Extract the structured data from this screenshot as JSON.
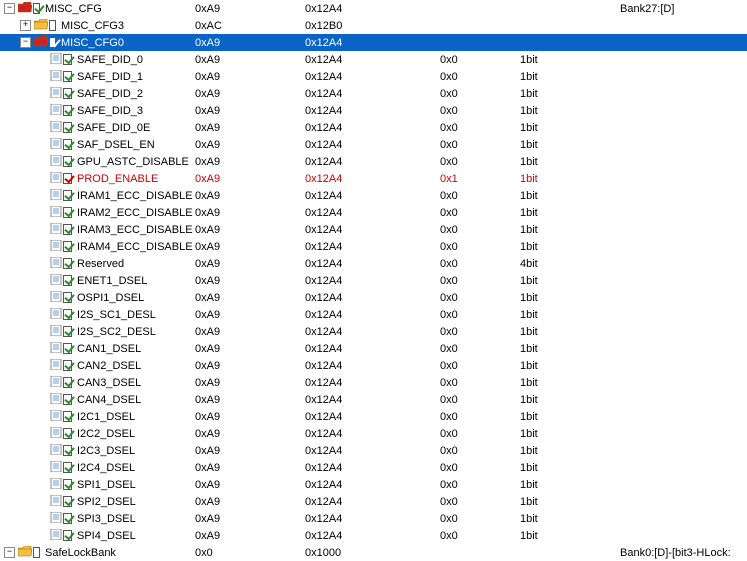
{
  "rows": [
    {
      "indent": 0,
      "toggle": "minus",
      "icon": "folder",
      "iconColor": "red",
      "check": "on",
      "label": "MISC_CFG",
      "c1": "0xA9",
      "c2": "0x12A4",
      "c3": "",
      "c4": "",
      "c5": "Bank27:[D]"
    },
    {
      "indent": 1,
      "toggle": "plus",
      "icon": "folder",
      "iconColor": "yellow",
      "check": "off",
      "label": "MISC_CFG3",
      "c1": "0xAC",
      "c2": "0x12B0",
      "c3": "",
      "c4": "",
      "c5": ""
    },
    {
      "indent": 1,
      "toggle": "minus",
      "icon": "folder",
      "iconColor": "red",
      "check": "on",
      "label": "MISC_CFG0",
      "c1": "0xA9",
      "c2": "0x12A4",
      "c3": "",
      "c4": "",
      "c5": "",
      "selected": true
    },
    {
      "indent": 2,
      "toggle": "none",
      "icon": "doc",
      "check": "on",
      "label": "SAFE_DID_0",
      "c1": "0xA9",
      "c2": "0x12A4",
      "c3": "0x0",
      "c4": "1bit",
      "c5": ""
    },
    {
      "indent": 2,
      "toggle": "none",
      "icon": "doc",
      "check": "on",
      "label": "SAFE_DID_1",
      "c1": "0xA9",
      "c2": "0x12A4",
      "c3": "0x0",
      "c4": "1bit",
      "c5": ""
    },
    {
      "indent": 2,
      "toggle": "none",
      "icon": "doc",
      "check": "on",
      "label": "SAFE_DID_2",
      "c1": "0xA9",
      "c2": "0x12A4",
      "c3": "0x0",
      "c4": "1bit",
      "c5": ""
    },
    {
      "indent": 2,
      "toggle": "none",
      "icon": "doc",
      "check": "on",
      "label": "SAFE_DID_3",
      "c1": "0xA9",
      "c2": "0x12A4",
      "c3": "0x0",
      "c4": "1bit",
      "c5": ""
    },
    {
      "indent": 2,
      "toggle": "none",
      "icon": "doc",
      "check": "on",
      "label": "SAFE_DID_0E",
      "c1": "0xA9",
      "c2": "0x12A4",
      "c3": "0x0",
      "c4": "1bit",
      "c5": ""
    },
    {
      "indent": 2,
      "toggle": "none",
      "icon": "doc",
      "check": "on",
      "label": "SAF_DSEL_EN",
      "c1": "0xA9",
      "c2": "0x12A4",
      "c3": "0x0",
      "c4": "1bit",
      "c5": ""
    },
    {
      "indent": 2,
      "toggle": "none",
      "icon": "doc",
      "check": "on",
      "label": "GPU_ASTC_DISABLE",
      "c1": "0xA9",
      "c2": "0x12A4",
      "c3": "0x0",
      "c4": "1bit",
      "c5": ""
    },
    {
      "indent": 2,
      "toggle": "none",
      "icon": "doc",
      "check": "on",
      "label": "PROD_ENABLE",
      "c1": "0xA9",
      "c2": "0x12A4",
      "c3": "0x1",
      "c4": "1bit",
      "c5": "",
      "highlight": true
    },
    {
      "indent": 2,
      "toggle": "none",
      "icon": "doc",
      "check": "on",
      "label": "IRAM1_ECC_DISABLE",
      "c1": "0xA9",
      "c2": "0x12A4",
      "c3": "0x0",
      "c4": "1bit",
      "c5": ""
    },
    {
      "indent": 2,
      "toggle": "none",
      "icon": "doc",
      "check": "on",
      "label": "IRAM2_ECC_DISABLE",
      "c1": "0xA9",
      "c2": "0x12A4",
      "c3": "0x0",
      "c4": "1bit",
      "c5": ""
    },
    {
      "indent": 2,
      "toggle": "none",
      "icon": "doc",
      "check": "on",
      "label": "IRAM3_ECC_DISABLE",
      "c1": "0xA9",
      "c2": "0x12A4",
      "c3": "0x0",
      "c4": "1bit",
      "c5": ""
    },
    {
      "indent": 2,
      "toggle": "none",
      "icon": "doc",
      "check": "on",
      "label": "IRAM4_ECC_DISABLE",
      "c1": "0xA9",
      "c2": "0x12A4",
      "c3": "0x0",
      "c4": "1bit",
      "c5": ""
    },
    {
      "indent": 2,
      "toggle": "none",
      "icon": "doc",
      "check": "on",
      "label": "Reserved",
      "c1": "0xA9",
      "c2": "0x12A4",
      "c3": "0x0",
      "c4": "4bit",
      "c5": ""
    },
    {
      "indent": 2,
      "toggle": "none",
      "icon": "doc",
      "check": "on",
      "label": "ENET1_DSEL",
      "c1": "0xA9",
      "c2": "0x12A4",
      "c3": "0x0",
      "c4": "1bit",
      "c5": ""
    },
    {
      "indent": 2,
      "toggle": "none",
      "icon": "doc",
      "check": "on",
      "label": "OSPI1_DSEL",
      "c1": "0xA9",
      "c2": "0x12A4",
      "c3": "0x0",
      "c4": "1bit",
      "c5": ""
    },
    {
      "indent": 2,
      "toggle": "none",
      "icon": "doc",
      "check": "on",
      "label": "I2S_SC1_DESL",
      "c1": "0xA9",
      "c2": "0x12A4",
      "c3": "0x0",
      "c4": "1bit",
      "c5": ""
    },
    {
      "indent": 2,
      "toggle": "none",
      "icon": "doc",
      "check": "on",
      "label": "I2S_SC2_DESL",
      "c1": "0xA9",
      "c2": "0x12A4",
      "c3": "0x0",
      "c4": "1bit",
      "c5": ""
    },
    {
      "indent": 2,
      "toggle": "none",
      "icon": "doc",
      "check": "on",
      "label": "CAN1_DSEL",
      "c1": "0xA9",
      "c2": "0x12A4",
      "c3": "0x0",
      "c4": "1bit",
      "c5": ""
    },
    {
      "indent": 2,
      "toggle": "none",
      "icon": "doc",
      "check": "on",
      "label": "CAN2_DSEL",
      "c1": "0xA9",
      "c2": "0x12A4",
      "c3": "0x0",
      "c4": "1bit",
      "c5": ""
    },
    {
      "indent": 2,
      "toggle": "none",
      "icon": "doc",
      "check": "on",
      "label": "CAN3_DSEL",
      "c1": "0xA9",
      "c2": "0x12A4",
      "c3": "0x0",
      "c4": "1bit",
      "c5": ""
    },
    {
      "indent": 2,
      "toggle": "none",
      "icon": "doc",
      "check": "on",
      "label": "CAN4_DSEL",
      "c1": "0xA9",
      "c2": "0x12A4",
      "c3": "0x0",
      "c4": "1bit",
      "c5": ""
    },
    {
      "indent": 2,
      "toggle": "none",
      "icon": "doc",
      "check": "on",
      "label": "I2C1_DSEL",
      "c1": "0xA9",
      "c2": "0x12A4",
      "c3": "0x0",
      "c4": "1bit",
      "c5": ""
    },
    {
      "indent": 2,
      "toggle": "none",
      "icon": "doc",
      "check": "on",
      "label": "I2C2_DSEL",
      "c1": "0xA9",
      "c2": "0x12A4",
      "c3": "0x0",
      "c4": "1bit",
      "c5": ""
    },
    {
      "indent": 2,
      "toggle": "none",
      "icon": "doc",
      "check": "on",
      "label": "I2C3_DSEL",
      "c1": "0xA9",
      "c2": "0x12A4",
      "c3": "0x0",
      "c4": "1bit",
      "c5": ""
    },
    {
      "indent": 2,
      "toggle": "none",
      "icon": "doc",
      "check": "on",
      "label": "I2C4_DSEL",
      "c1": "0xA9",
      "c2": "0x12A4",
      "c3": "0x0",
      "c4": "1bit",
      "c5": ""
    },
    {
      "indent": 2,
      "toggle": "none",
      "icon": "doc",
      "check": "on",
      "label": "SPI1_DSEL",
      "c1": "0xA9",
      "c2": "0x12A4",
      "c3": "0x0",
      "c4": "1bit",
      "c5": ""
    },
    {
      "indent": 2,
      "toggle": "none",
      "icon": "doc",
      "check": "on",
      "label": "SPI2_DSEL",
      "c1": "0xA9",
      "c2": "0x12A4",
      "c3": "0x0",
      "c4": "1bit",
      "c5": ""
    },
    {
      "indent": 2,
      "toggle": "none",
      "icon": "doc",
      "check": "on",
      "label": "SPI3_DSEL",
      "c1": "0xA9",
      "c2": "0x12A4",
      "c3": "0x0",
      "c4": "1bit",
      "c5": ""
    },
    {
      "indent": 2,
      "toggle": "none",
      "icon": "doc",
      "check": "on",
      "label": "SPI4_DSEL",
      "c1": "0xA9",
      "c2": "0x12A4",
      "c3": "0x0",
      "c4": "1bit",
      "c5": ""
    },
    {
      "indent": 0,
      "toggle": "minus",
      "icon": "folder",
      "iconColor": "yellow",
      "check": "off",
      "label": "SafeLockBank",
      "c1": "0x0",
      "c2": "0x1000",
      "c3": "",
      "c4": "",
      "c5": "Bank0:[D]-[bit3-HLock:"
    }
  ]
}
